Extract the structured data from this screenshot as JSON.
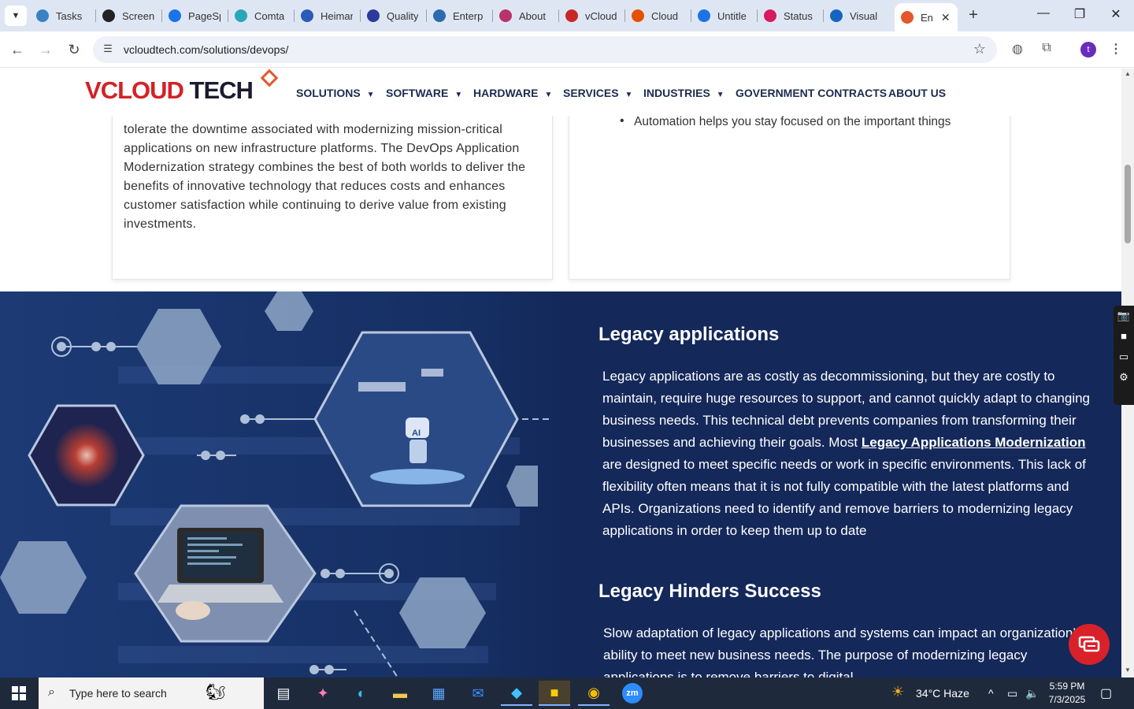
{
  "browser": {
    "tabs": [
      {
        "label": "Tasks",
        "color": "#3b82c4"
      },
      {
        "label": "Screen",
        "color": "#222222"
      },
      {
        "label": "PageSp",
        "color": "#1a73e8"
      },
      {
        "label": "Comta",
        "color": "#2aa6b8"
      },
      {
        "label": "Heiman",
        "color": "#2a5bb8"
      },
      {
        "label": "Quality",
        "color": "#2b3a9c"
      },
      {
        "label": "Enterp",
        "color": "#2b6cb0"
      },
      {
        "label": "About",
        "color": "#b8336a"
      },
      {
        "label": "vCloud",
        "color": "#c62828"
      },
      {
        "label": "Cloud",
        "color": "#e65100"
      },
      {
        "label": "Untitle",
        "color": "#1a73e8"
      },
      {
        "label": "Status",
        "color": "#d81b60"
      },
      {
        "label": "Visual",
        "color": "#1565c0"
      },
      {
        "label": "En",
        "color": "#e2582a"
      }
    ],
    "active_tab_close": "✕",
    "new_tab": "+",
    "url": "vcloudtech.com/solutions/devops/",
    "profile_initial": "t"
  },
  "site": {
    "logo_v": "V",
    "logo_cloud": "CLOUD",
    "logo_tech": " TECH",
    "menu": [
      {
        "label": "SOLUTIONS",
        "caret": true
      },
      {
        "label": "SOFTWARE",
        "caret": true
      },
      {
        "label": "HARDWARE",
        "caret": true
      },
      {
        "label": "SERVICES",
        "caret": true
      },
      {
        "label": "INDUSTRIES",
        "caret": true
      },
      {
        "label": "GOVERNMENT CONTRACTS",
        "caret": false
      },
      {
        "label": "ABOUT US",
        "caret": false
      }
    ]
  },
  "cards": {
    "left_text": "tolerate the downtime associated with modernizing mission-critical applications on new infrastructure platforms. The DevOps Application Modernization strategy combines the best of both worlds to deliver the benefits of innovative technology that reduces costs and enhances customer satisfaction while continuing to derive value from existing investments.",
    "right_bullet": "Automation helps you stay focused on the important things"
  },
  "section": {
    "heading1": "Legacy applications",
    "para1_before": "Legacy applications are as costly as decommissioning, but they are costly to maintain, require huge resources to support, and cannot quickly adapt to changing business needs. This technical debt prevents companies from transforming their businesses and achieving their goals. Most ",
    "para1_link": "Legacy Applications Modernization",
    "para1_after": " are designed to meet specific needs or work in specific environments. This lack of flexibility often means that it is not fully compatible with the latest platforms and APIs. Organizations need to identify and remove barriers to modernizing legacy applications in order to keep them up to date",
    "heading2": "Legacy Hinders Success",
    "para2": "Slow adaptation of legacy applications and systems can impact an organization’s ability to meet new business needs. The purpose of modernizing legacy applications is to remove barriers to digital"
  },
  "taskbar": {
    "search_placeholder": "Type here to search",
    "weather": "34°C  Haze",
    "time": "5:59 PM",
    "date": "7/3/2025"
  }
}
